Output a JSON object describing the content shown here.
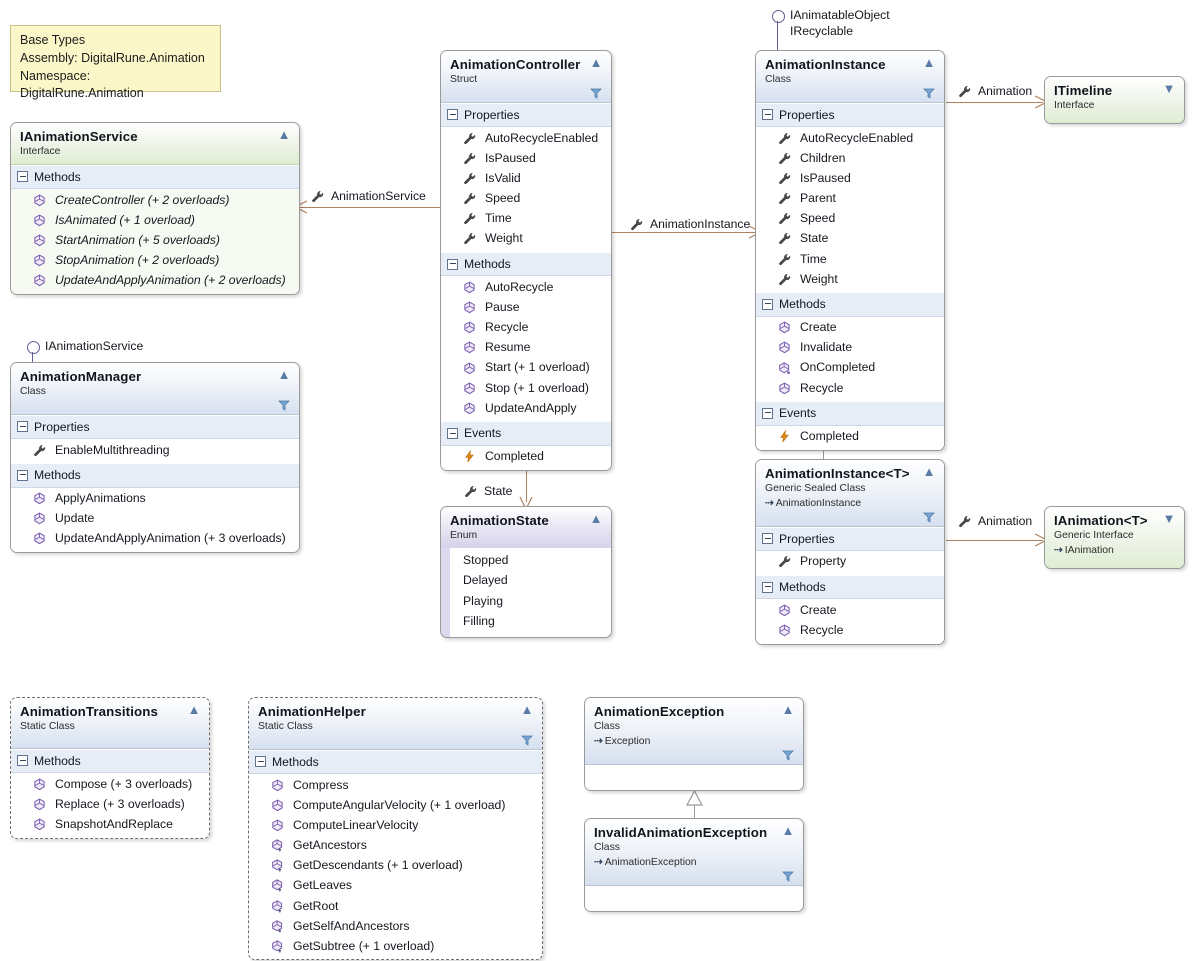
{
  "note": {
    "lines": [
      "Base Types",
      "Assembly: DigitalRune.Animation",
      "Namespace: DigitalRune.Animation"
    ]
  },
  "shapes": {
    "ianimationservice": {
      "title": "IAnimationService",
      "stereotype": "Interface",
      "groups": [
        {
          "label": "Methods",
          "members": [
            {
              "icon": "method-icon",
              "text": "CreateController (+ 2 overloads)"
            },
            {
              "icon": "method-icon",
              "text": "IsAnimated (+ 1 overload)"
            },
            {
              "icon": "method-icon",
              "text": "StartAnimation (+ 5 overloads)"
            },
            {
              "icon": "method-icon",
              "text": "StopAnimation (+ 2 overloads)"
            },
            {
              "icon": "method-icon",
              "text": "UpdateAndApplyAnimation (+ 2 overloads)"
            }
          ]
        }
      ]
    },
    "animationmanager": {
      "title": "AnimationManager",
      "stereotype": "Class",
      "lollipop": "IAnimationService",
      "groups": [
        {
          "label": "Properties",
          "members": [
            {
              "icon": "property-icon",
              "text": "EnableMultithreading"
            }
          ]
        },
        {
          "label": "Methods",
          "members": [
            {
              "icon": "method-icon",
              "text": "ApplyAnimations"
            },
            {
              "icon": "method-icon",
              "text": "Update"
            },
            {
              "icon": "method-icon",
              "text": "UpdateAndApplyAnimation (+ 3 overloads)"
            }
          ]
        }
      ]
    },
    "animationcontroller": {
      "title": "AnimationController",
      "stereotype": "Struct",
      "groups": [
        {
          "label": "Properties",
          "members": [
            {
              "icon": "property-icon",
              "text": "AutoRecycleEnabled"
            },
            {
              "icon": "property-icon",
              "text": "IsPaused"
            },
            {
              "icon": "property-icon",
              "text": "IsValid"
            },
            {
              "icon": "property-icon",
              "text": "Speed"
            },
            {
              "icon": "property-icon",
              "text": "Time"
            },
            {
              "icon": "property-icon",
              "text": "Weight"
            }
          ]
        },
        {
          "label": "Methods",
          "members": [
            {
              "icon": "method-icon",
              "text": "AutoRecycle"
            },
            {
              "icon": "method-icon",
              "text": "Pause"
            },
            {
              "icon": "method-icon",
              "text": "Recycle"
            },
            {
              "icon": "method-icon",
              "text": "Resume"
            },
            {
              "icon": "method-icon",
              "text": "Start (+ 1 overload)"
            },
            {
              "icon": "method-icon",
              "text": "Stop (+ 1 overload)"
            },
            {
              "icon": "method-icon",
              "text": "UpdateAndApply"
            }
          ]
        },
        {
          "label": "Events",
          "members": [
            {
              "icon": "event-icon",
              "text": "Completed"
            }
          ]
        }
      ]
    },
    "animationinstance": {
      "title": "AnimationInstance",
      "stereotype": "Class",
      "lollipop": [
        "IAnimatableObject",
        "IRecyclable"
      ],
      "groups": [
        {
          "label": "Properties",
          "members": [
            {
              "icon": "property-icon",
              "text": "AutoRecycleEnabled"
            },
            {
              "icon": "property-icon",
              "text": "Children"
            },
            {
              "icon": "property-icon",
              "text": "IsPaused"
            },
            {
              "icon": "property-icon",
              "text": "Parent"
            },
            {
              "icon": "property-icon",
              "text": "Speed"
            },
            {
              "icon": "property-icon",
              "text": "State"
            },
            {
              "icon": "property-icon",
              "text": "Time"
            },
            {
              "icon": "property-icon",
              "text": "Weight"
            }
          ]
        },
        {
          "label": "Methods",
          "members": [
            {
              "icon": "method-icon",
              "text": "Create"
            },
            {
              "icon": "method-icon",
              "text": "Invalidate"
            },
            {
              "icon": "method-protected-icon",
              "text": "OnCompleted"
            },
            {
              "icon": "method-icon",
              "text": "Recycle"
            }
          ]
        },
        {
          "label": "Events",
          "members": [
            {
              "icon": "event-icon",
              "text": "Completed"
            }
          ]
        }
      ]
    },
    "itimeline": {
      "title": "ITimeline",
      "stereotype": "Interface",
      "collapsed": true
    },
    "animationinstance_t": {
      "title": "AnimationInstance<T>",
      "stereotype": "Generic Sealed Class",
      "base": "AnimationInstance",
      "groups": [
        {
          "label": "Properties",
          "members": [
            {
              "icon": "property-icon",
              "text": "Property"
            }
          ]
        },
        {
          "label": "Methods",
          "members": [
            {
              "icon": "method-icon",
              "text": "Create"
            },
            {
              "icon": "method-icon",
              "text": "Recycle"
            }
          ]
        }
      ]
    },
    "ianimation_t": {
      "title": "IAnimation<T>",
      "stereotype": "Generic Interface",
      "base": "IAnimation",
      "collapsed": true
    },
    "animationstate": {
      "title": "AnimationState",
      "stereotype": "Enum",
      "values": [
        "Stopped",
        "Delayed",
        "Playing",
        "Filling"
      ]
    },
    "animationtransitions": {
      "title": "AnimationTransitions",
      "stereotype": "Static Class",
      "groups": [
        {
          "label": "Methods",
          "members": [
            {
              "icon": "method-icon",
              "text": "Compose (+ 3 overloads)"
            },
            {
              "icon": "method-icon",
              "text": "Replace (+ 3 overloads)"
            },
            {
              "icon": "method-icon",
              "text": "SnapshotAndReplace"
            }
          ]
        }
      ]
    },
    "animationhelper": {
      "title": "AnimationHelper",
      "stereotype": "Static Class",
      "groups": [
        {
          "label": "Methods",
          "members": [
            {
              "icon": "method-icon",
              "text": "Compress"
            },
            {
              "icon": "method-icon",
              "text": "ComputeAngularVelocity (+ 1 overload)"
            },
            {
              "icon": "method-icon",
              "text": "ComputeLinearVelocity"
            },
            {
              "icon": "method-extension-icon",
              "text": "GetAncestors"
            },
            {
              "icon": "method-extension-icon",
              "text": "GetDescendants (+ 1 overload)"
            },
            {
              "icon": "method-extension-icon",
              "text": "GetLeaves"
            },
            {
              "icon": "method-extension-icon",
              "text": "GetRoot"
            },
            {
              "icon": "method-extension-icon",
              "text": "GetSelfAndAncestors"
            },
            {
              "icon": "method-extension-icon",
              "text": "GetSubtree (+ 1 overload)"
            }
          ]
        }
      ]
    },
    "animationexception": {
      "title": "AnimationException",
      "stereotype": "Class",
      "base": "Exception"
    },
    "invalidanimationexception": {
      "title": "InvalidAnimationException",
      "stereotype": "Class",
      "base": "AnimationException"
    }
  },
  "connectors": {
    "animation_service": "AnimationService",
    "animation_instance": "AnimationInstance",
    "animation_timeline": "Animation",
    "animation_generic": "Animation",
    "state": "State"
  },
  "colors": {
    "association": "#b0815e",
    "inheritance": "#9a9a9a",
    "note_bg": "#FBF7C8",
    "class_header": "#d6e0ef",
    "interface_header": "#dfecd2",
    "enum_header": "#d7d2ea"
  }
}
